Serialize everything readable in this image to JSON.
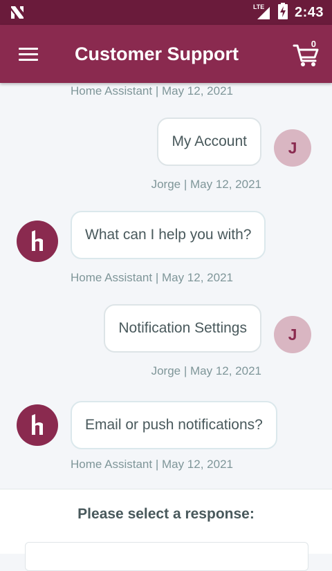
{
  "status_bar": {
    "network": "LTE",
    "time": "2:43"
  },
  "app_bar": {
    "title": "Customer Support",
    "cart_count": "0"
  },
  "messages": [
    {
      "from": "assistant",
      "meta": "Home Assistant | May 12, 2021"
    },
    {
      "from": "user",
      "text": "My Account",
      "avatar": "J",
      "meta": "Jorge | May 12, 2021"
    },
    {
      "from": "assistant",
      "text": "What can I help you with?",
      "meta": "Home Assistant | May 12, 2021"
    },
    {
      "from": "user",
      "text": "Notification Settings",
      "avatar": "J",
      "meta": "Jorge | May 12, 2021"
    },
    {
      "from": "assistant",
      "text": "Email or push notifications?",
      "meta": "Home Assistant | May 12, 2021"
    }
  ],
  "response_panel": {
    "prompt": "Please select a response:"
  },
  "colors": {
    "status_bar": "#6a1b3b",
    "app_bar": "#8a2a4f",
    "avatar_user_bg": "#d9b6c2",
    "meta_text": "#7f9699",
    "bubble_text": "#49595c"
  },
  "icons": {
    "notification": "n-logo-icon",
    "signal": "signal-icon",
    "battery": "battery-charging-icon",
    "menu": "menu-icon",
    "cart": "shopping-cart-icon",
    "assistant_avatar": "h-logo-icon"
  }
}
